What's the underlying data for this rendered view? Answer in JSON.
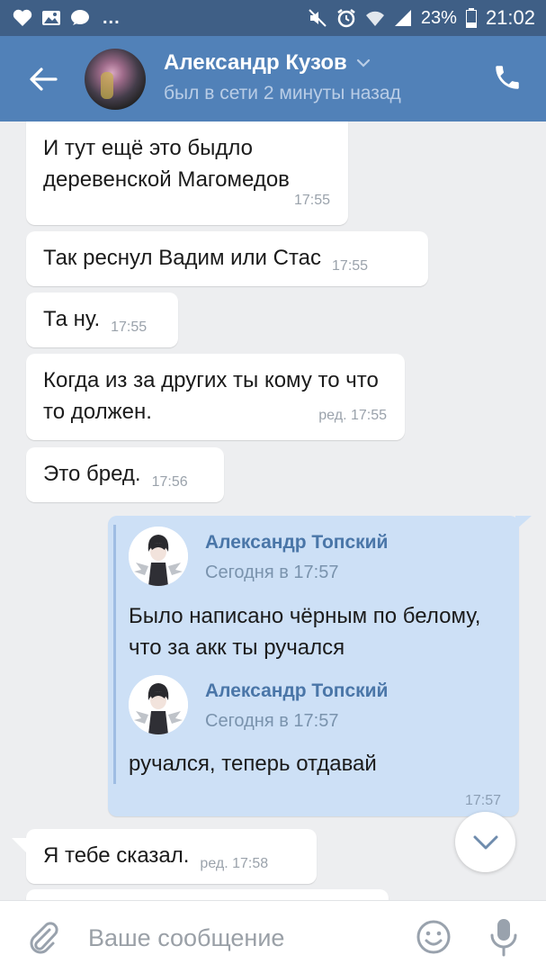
{
  "status_bar": {
    "dots": "...",
    "battery": "23%",
    "time": "21:02"
  },
  "header": {
    "contact_name": "Александр Кузов",
    "contact_status": "был в сети 2 минуты назад"
  },
  "messages": [
    {
      "text": "И тут ещё это быдло деревенской Магомедов",
      "time": "17:55"
    },
    {
      "text": "Так реснул Вадим или Стас",
      "time": "17:55"
    },
    {
      "text": "Та ну.",
      "time": "17:55"
    },
    {
      "text": "Когда из за других ты кому то что то должен.",
      "time": "ред. 17:55"
    },
    {
      "text": "Это бред.",
      "time": "17:56"
    },
    {
      "time": "17:57"
    },
    {
      "text": "Я тебе сказал.",
      "time": "ред. 17:58"
    }
  ],
  "forwarded": [
    {
      "author": "Александр Топский",
      "date": "Сегодня в 17:57",
      "text": "Было написано чёрным по белому, что за акк ты ручался"
    },
    {
      "author": "Александр Топский",
      "date": "Сегодня в 17:57",
      "text": "ручался, теперь отдавай"
    }
  ],
  "composer": {
    "placeholder": "Ваше сообщение"
  },
  "colors": {
    "status_bar": "#3f5f86",
    "header": "#5181b8",
    "background": "#edeef0",
    "outgoing_bubble": "#cde0f6",
    "link": "#4a76a8"
  },
  "icons": {
    "status_left": [
      "heart-icon",
      "image-icon",
      "chat-icon"
    ],
    "status_right": [
      "mute-icon",
      "alarm-icon",
      "wifi-icon",
      "signal-icon",
      "battery-icon"
    ],
    "header": [
      "back-arrow-icon",
      "chevron-down-icon",
      "phone-icon"
    ],
    "composer": [
      "paperclip-icon",
      "emoji-icon",
      "mic-icon"
    ],
    "scroll": "chevron-down-icon"
  }
}
